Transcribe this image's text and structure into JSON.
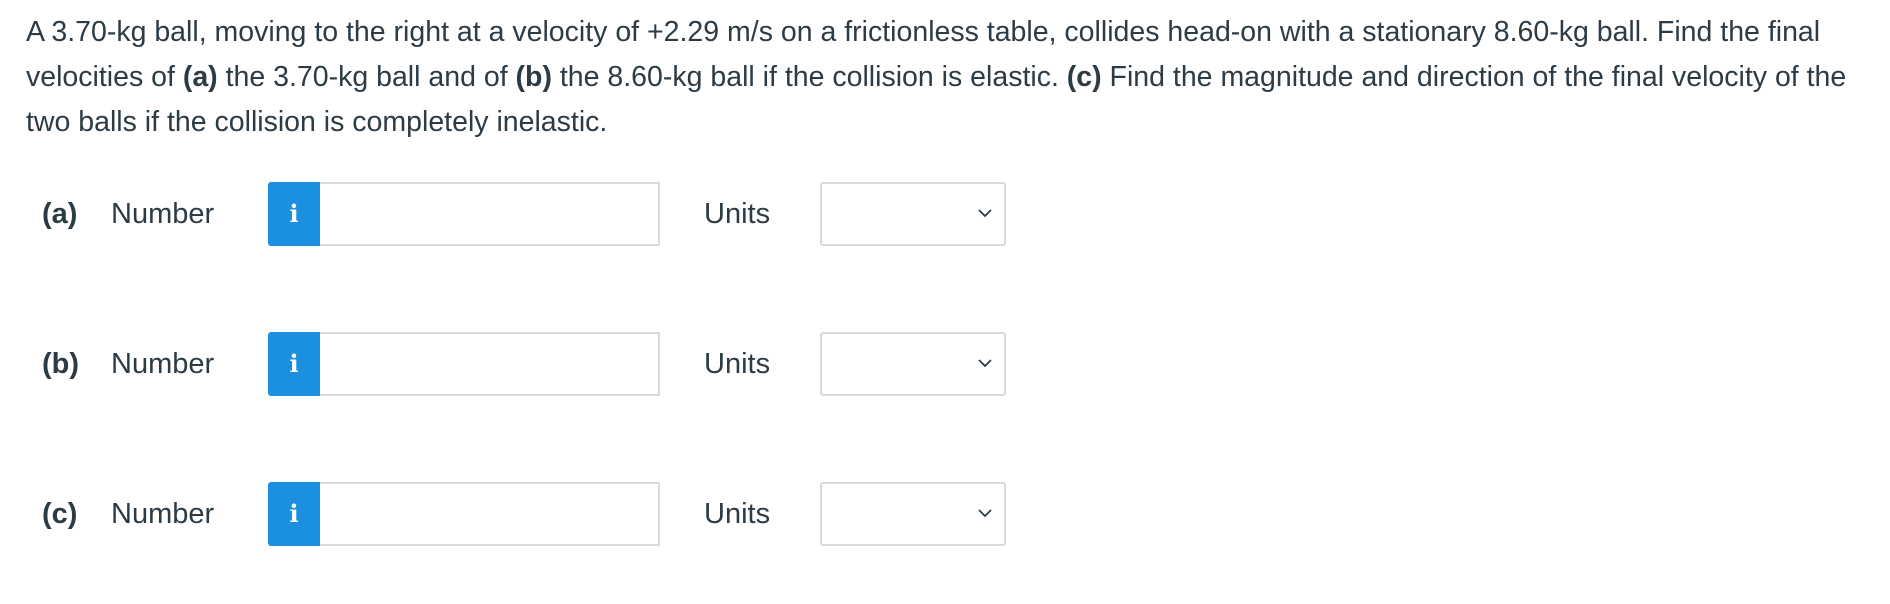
{
  "question": {
    "seg1": "A 3.70-kg ball, moving to the right at a velocity of +2.29 m/s on a frictionless table, collides head-on with a stationary 8.60-kg ball. Find the final velocities of ",
    "a_marker": "(a)",
    "seg2": " the 3.70-kg ball and of ",
    "b_marker": "(b)",
    "seg3": " the 8.60-kg ball if the collision is elastic. ",
    "c_marker": "(c)",
    "seg4": " Find the magnitude and direction of the final velocity of the two balls if the collision is completely inelastic."
  },
  "parts": [
    {
      "label": "(a)",
      "number_label": "Number",
      "info_icon": "i",
      "number_value": "",
      "units_label": "Units",
      "units_selected": ""
    },
    {
      "label": "(b)",
      "number_label": "Number",
      "info_icon": "i",
      "number_value": "",
      "units_label": "Units",
      "units_selected": ""
    },
    {
      "label": "(c)",
      "number_label": "Number",
      "info_icon": "i",
      "number_value": "",
      "units_label": "Units",
      "units_selected": ""
    }
  ],
  "icons": {
    "info": "info-icon",
    "dropdown": "chevron-down-icon"
  },
  "colors": {
    "info_button": "#1b8fe0",
    "text": "#2d3b45",
    "border": "#d9d9d9"
  }
}
